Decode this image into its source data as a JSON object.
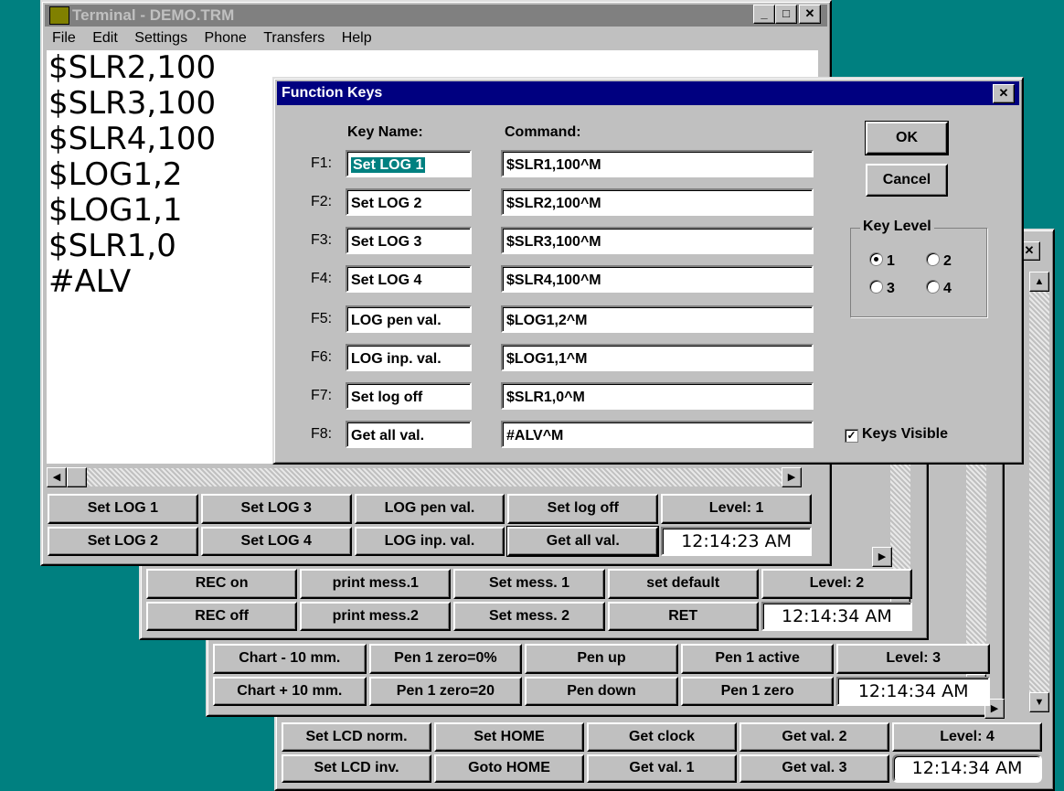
{
  "terminal": {
    "title": "Terminal - DEMO.TRM",
    "menu": [
      "File",
      "Edit",
      "Settings",
      "Phone",
      "Transfers",
      "Help"
    ],
    "lines": [
      "$SLR2,100",
      "$SLR3,100",
      "$SLR4,100",
      "$LOG1,2",
      "$LOG1,1",
      "$SLR1,0",
      "#ALV"
    ]
  },
  "keysets": [
    {
      "row1": [
        "Set LOG 1",
        "Set LOG 3",
        "LOG pen val.",
        "Set log off"
      ],
      "row2": [
        "Set LOG 2",
        "Set LOG 4",
        "LOG inp. val.",
        "Get all val."
      ],
      "level": "Level: 1",
      "clock": "12:14:23 AM"
    },
    {
      "row1": [
        "REC on",
        "print mess.1",
        "Set mess. 1",
        "set default"
      ],
      "row2": [
        "REC off",
        "print mess.2",
        "Set mess. 2",
        "RET"
      ],
      "level": "Level: 2",
      "clock": "12:14:34 AM"
    },
    {
      "row1": [
        "Chart - 10 mm.",
        "Pen 1 zero=0%",
        "Pen up",
        "Pen 1 active"
      ],
      "row2": [
        "Chart + 10 mm.",
        "Pen 1 zero=20",
        "Pen down",
        "Pen 1 zero"
      ],
      "level": "Level: 3",
      "clock": "12:14:34 AM"
    },
    {
      "row1": [
        "Set LCD norm.",
        "Set HOME",
        "Get clock",
        "Get val. 2"
      ],
      "row2": [
        "Set LCD inv.",
        "Goto HOME",
        "Get val. 1",
        "Get val. 3"
      ],
      "level": "Level: 4",
      "clock": "12:14:34 AM"
    }
  ],
  "dialog": {
    "title": "Function Keys",
    "key_name_header": "Key Name:",
    "command_header": "Command:",
    "rows": [
      {
        "fkey": "F1:",
        "name": "Set LOG 1",
        "command": "$SLR1,100^M"
      },
      {
        "fkey": "F2:",
        "name": "Set LOG 2",
        "command": "$SLR2,100^M"
      },
      {
        "fkey": "F3:",
        "name": "Set LOG 3",
        "command": "$SLR3,100^M"
      },
      {
        "fkey": "F4:",
        "name": "Set LOG 4",
        "command": "$SLR4,100^M"
      },
      {
        "fkey": "F5:",
        "name": "LOG pen val.",
        "command": "$LOG1,2^M"
      },
      {
        "fkey": "F6:",
        "name": "LOG inp. val.",
        "command": "$LOG1,1^M"
      },
      {
        "fkey": "F7:",
        "name": "Set log off",
        "command": "$SLR1,0^M"
      },
      {
        "fkey": "F8:",
        "name": "Get all val.",
        "command": "#ALV^M"
      }
    ],
    "ok_label": "OK",
    "cancel_label": "Cancel",
    "key_level_label": "Key Level",
    "levels": [
      "1",
      "2",
      "3",
      "4"
    ],
    "selected_level": "1",
    "keys_visible_label": "Keys Visible",
    "keys_visible": true
  }
}
